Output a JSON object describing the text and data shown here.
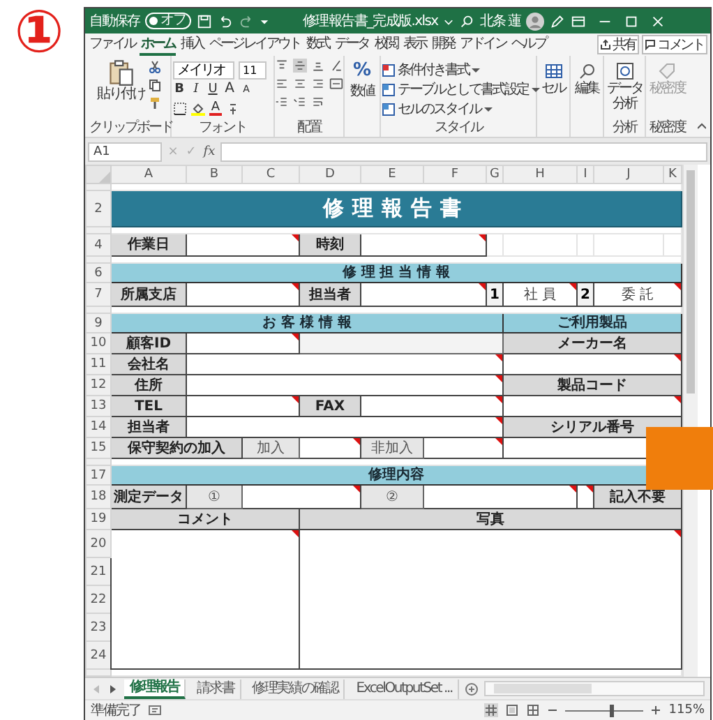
{
  "badge": "①",
  "window": {
    "autosave": {
      "label": "自動保存",
      "state": "オフ",
      "on": false
    },
    "title": "修理報告書_完成版.xlsx",
    "user": "北条 蓮"
  },
  "tabs": [
    {
      "label": "ファイル",
      "selected": false
    },
    {
      "label": "ホーム",
      "selected": true
    },
    {
      "label": "挿入",
      "selected": false
    },
    {
      "label": "ページレイアウト",
      "selected": false
    },
    {
      "label": "数式",
      "selected": false
    },
    {
      "label": "データ",
      "selected": false
    },
    {
      "label": "校閲",
      "selected": false
    },
    {
      "label": "表示",
      "selected": false
    },
    {
      "label": "開発",
      "selected": false
    },
    {
      "label": "アドイン",
      "selected": false
    },
    {
      "label": "ヘルプ",
      "selected": false
    }
  ],
  "share_button": "共有",
  "comment_button": "コメント",
  "ribbon": {
    "clipboard": {
      "paste": "貼り付け",
      "label": "クリップボード"
    },
    "font": {
      "name": "メイリオ",
      "size": "11",
      "styles": [
        "B",
        "I",
        "U"
      ],
      "grow": "A",
      "shrink": "A",
      "color_button": "A",
      "label": "フォント"
    },
    "alignment": {
      "label": "配置"
    },
    "number": {
      "symbol": "%",
      "button": "数値"
    },
    "styles": {
      "items": [
        "条件付き書式",
        "テーブルとして書式設定",
        "セルのスタイル"
      ],
      "label": "スタイル"
    },
    "cells": {
      "button": "セル"
    },
    "editing": {
      "button": "編集"
    },
    "analysis": {
      "button": "データ分析",
      "label": "分析"
    },
    "sensitivity": {
      "button": "秘密度",
      "label": "秘密度"
    }
  },
  "formula_bar": {
    "cell_ref": "A1",
    "cancel": "×",
    "enter": "✓",
    "function": "fx"
  },
  "sheet": {
    "columns": [
      "A",
      "B",
      "C",
      "D",
      "E",
      "F",
      "G",
      "H",
      "I",
      "J",
      "K"
    ],
    "rows": [
      {
        "kind": "spacer"
      },
      {
        "number": "2",
        "kind": "title",
        "cells": [
          {
            "kind": "title",
            "text": "修理報告書",
            "comment": false
          }
        ]
      },
      {
        "kind": "spacer"
      },
      {
        "number": "4",
        "kind": "datetime",
        "cells": [
          {
            "kind": "label",
            "text": "作業日",
            "comment": false
          },
          {
            "kind": "input",
            "comment": true
          },
          {
            "kind": "label",
            "text": "時刻",
            "comment": false
          },
          {
            "kind": "input",
            "comment": true
          }
        ]
      },
      {
        "kind": "spacer"
      },
      {
        "number": "6",
        "kind": "band",
        "cells": [
          {
            "kind": "band",
            "text": "修 理 担 当 情 報",
            "comment": false
          }
        ]
      },
      {
        "number": "7",
        "kind": "staff",
        "cells": [
          {
            "kind": "label",
            "text": "所属支店",
            "comment": false
          },
          {
            "kind": "input",
            "comment": true
          },
          {
            "kind": "label",
            "text": "担当者",
            "comment": false
          },
          {
            "kind": "input",
            "comment": true
          },
          {
            "kind": "num",
            "text": "1",
            "comment": false
          },
          {
            "kind": "value",
            "text": "社 員",
            "comment": true
          },
          {
            "kind": "num",
            "text": "2",
            "comment": false
          },
          {
            "kind": "value",
            "text": "委 託",
            "comment": true
          }
        ]
      },
      {
        "kind": "spacer"
      },
      {
        "number": "9",
        "kind": "split",
        "cells": [
          {
            "kind": "band",
            "text": "お 客 様 情 報",
            "comment": false
          },
          {
            "kind": "band",
            "text": "ご利用製品",
            "comment": false
          }
        ]
      },
      {
        "number": "10",
        "kind": "cust_id",
        "cells": [
          {
            "kind": "label",
            "text": "顧客ID",
            "comment": false
          },
          {
            "kind": "input",
            "comment": true
          },
          {
            "kind": "shade",
            "comment": false
          },
          {
            "kind": "label",
            "text": "メーカー名",
            "comment": false
          }
        ]
      },
      {
        "number": "11",
        "kind": "wide",
        "cells": [
          {
            "kind": "label",
            "text": "会社名",
            "comment": false
          },
          {
            "kind": "input",
            "comment": true
          },
          {
            "kind": "input",
            "comment": true
          }
        ]
      },
      {
        "number": "12",
        "kind": "wide",
        "cells": [
          {
            "kind": "label",
            "text": "住所",
            "comment": false
          },
          {
            "kind": "input",
            "comment": true
          },
          {
            "kind": "label",
            "text": "製品コード",
            "comment": false
          }
        ]
      },
      {
        "number": "13",
        "kind": "telfax",
        "cells": [
          {
            "kind": "label",
            "text": "TEL",
            "comment": false
          },
          {
            "kind": "input",
            "comment": true
          },
          {
            "kind": "label",
            "text": "FAX",
            "comment": false
          },
          {
            "kind": "input",
            "comment": true
          },
          {
            "kind": "input",
            "comment": true
          }
        ]
      },
      {
        "number": "14",
        "kind": "wide",
        "cells": [
          {
            "kind": "label",
            "text": "担当者",
            "comment": false
          },
          {
            "kind": "input",
            "comment": true
          },
          {
            "kind": "label",
            "text": "シリアル番号",
            "comment": false
          }
        ]
      },
      {
        "number": "15",
        "kind": "contract",
        "cells": [
          {
            "kind": "label",
            "text": "保守契約の加入",
            "comment": false
          },
          {
            "kind": "sub",
            "text": "加入",
            "comment": false
          },
          {
            "kind": "input",
            "comment": true
          },
          {
            "kind": "sub",
            "text": "非加入",
            "comment": false
          },
          {
            "kind": "input",
            "comment": true
          },
          {
            "kind": "input",
            "comment": false
          }
        ]
      },
      {
        "kind": "spacer"
      },
      {
        "number": "17",
        "kind": "band",
        "cells": [
          {
            "kind": "band",
            "text": "修理内容",
            "comment": false
          }
        ]
      },
      {
        "number": "18",
        "kind": "measure",
        "cells": [
          {
            "kind": "label",
            "text": "測定データ",
            "comment": false
          },
          {
            "kind": "sub",
            "text": "①",
            "comment": false
          },
          {
            "kind": "input",
            "comment": true
          },
          {
            "kind": "sub",
            "text": "②",
            "comment": false
          },
          {
            "kind": "input",
            "comment": true
          },
          {
            "kind": "input",
            "comment": true
          },
          {
            "kind": "label",
            "text": "記入不要",
            "comment": false
          }
        ]
      },
      {
        "number": "19",
        "kind": "heads",
        "cells": [
          {
            "kind": "label",
            "text": "コメント",
            "comment": false
          },
          {
            "kind": "label",
            "text": "写真",
            "comment": false
          }
        ]
      },
      {
        "number": "20",
        "kind": "area",
        "cells": [
          {
            "kind": "input",
            "comment": true
          },
          {
            "kind": "input",
            "comment": true
          }
        ]
      },
      {
        "number": "21",
        "kind": "cont"
      },
      {
        "number": "22",
        "kind": "cont"
      },
      {
        "number": "23",
        "kind": "cont"
      },
      {
        "number": "24",
        "kind": "cont"
      },
      {
        "kind": "spacer"
      }
    ]
  },
  "sheet_tabs": [
    {
      "label": "修理報告",
      "selected": true
    },
    {
      "label": "請求書",
      "selected": false
    },
    {
      "label": "修理実績の確認",
      "selected": false
    },
    {
      "label": "ExcelOutputSet ...",
      "selected": false
    }
  ],
  "status_bar": {
    "status": "準備完了",
    "zoom": "115%",
    "zoom_slider": {
      "level": 0.58
    }
  }
}
